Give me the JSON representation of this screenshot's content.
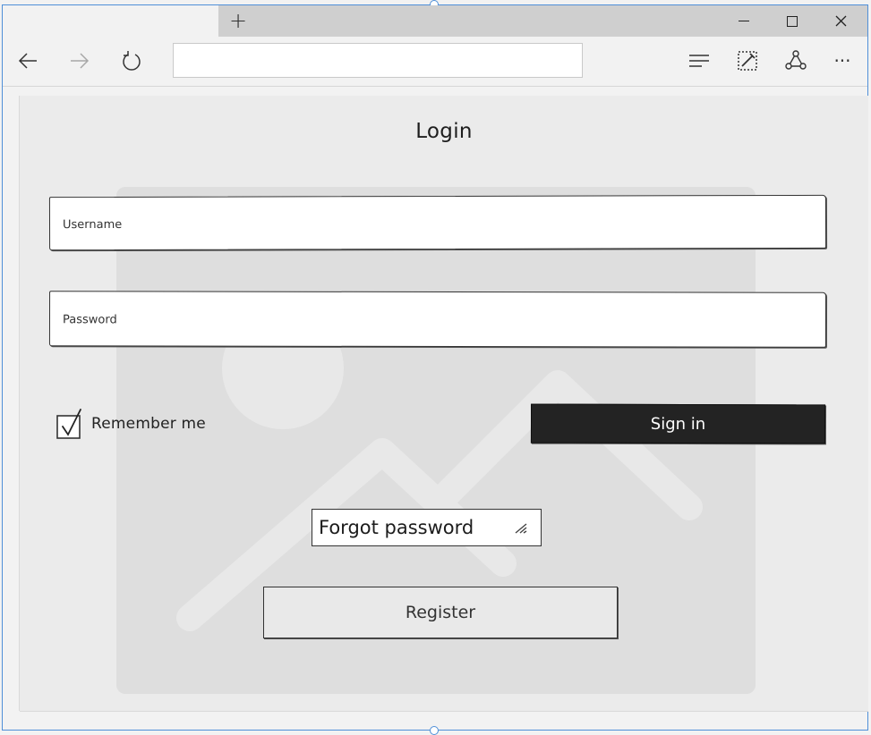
{
  "window": {
    "new_tab_glyph": "+",
    "address_value": ""
  },
  "toolbar": {
    "back_icon": "back-arrow-icon",
    "forward_icon": "forward-arrow-icon",
    "refresh_icon": "refresh-icon",
    "hub_icon": "hub-icon",
    "note_icon": "web-note-icon",
    "share_icon": "share-icon",
    "more_label": "···"
  },
  "form": {
    "title": "Login",
    "username_placeholder": "Username",
    "password_placeholder": "Password",
    "remember_label": "Remember me",
    "remember_checked": true,
    "signin_label": "Sign in",
    "forgot_label": "Forgot password",
    "register_label": "Register"
  },
  "colors": {
    "selection": "#4f8fd8",
    "signin_bg": "#232323",
    "canvas_bg": "#ebebeb",
    "placeholder_bg": "#dedede"
  }
}
